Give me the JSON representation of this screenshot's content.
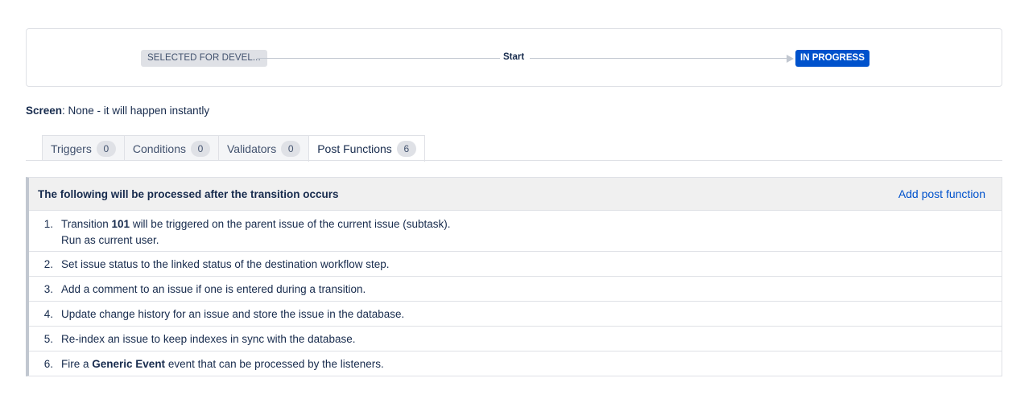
{
  "diagram": {
    "from_status": "SELECTED FOR DEVEL...",
    "transition_name": "Start",
    "to_status": "IN PROGRESS",
    "colors": {
      "to_status_bg": "#0052cc",
      "from_status_bg": "#dfe1e6"
    }
  },
  "screen": {
    "label": "Screen",
    "value": ": None - it will happen instantly"
  },
  "tabs": [
    {
      "label": "Triggers",
      "count": "0"
    },
    {
      "label": "Conditions",
      "count": "0"
    },
    {
      "label": "Validators",
      "count": "0"
    },
    {
      "label": "Post Functions",
      "count": "6",
      "active": true
    }
  ],
  "panel": {
    "title": "The following will be processed after the transition occurs",
    "add_link": "Add post function",
    "items": [
      {
        "num": "1.",
        "pre": "Transition ",
        "bold": "101",
        "post": " will be triggered on the parent issue of the current issue (subtask).",
        "line2": "Run as current user."
      },
      {
        "num": "2.",
        "text": "Set issue status to the linked status of the destination workflow step."
      },
      {
        "num": "3.",
        "text": "Add a comment to an issue if one is entered during a transition."
      },
      {
        "num": "4.",
        "text": "Update change history for an issue and store the issue in the database."
      },
      {
        "num": "5.",
        "text": "Re-index an issue to keep indexes in sync with the database."
      },
      {
        "num": "6.",
        "pre": "Fire a ",
        "bold": "Generic Event",
        "post": " event that can be processed by the listeners."
      }
    ]
  }
}
